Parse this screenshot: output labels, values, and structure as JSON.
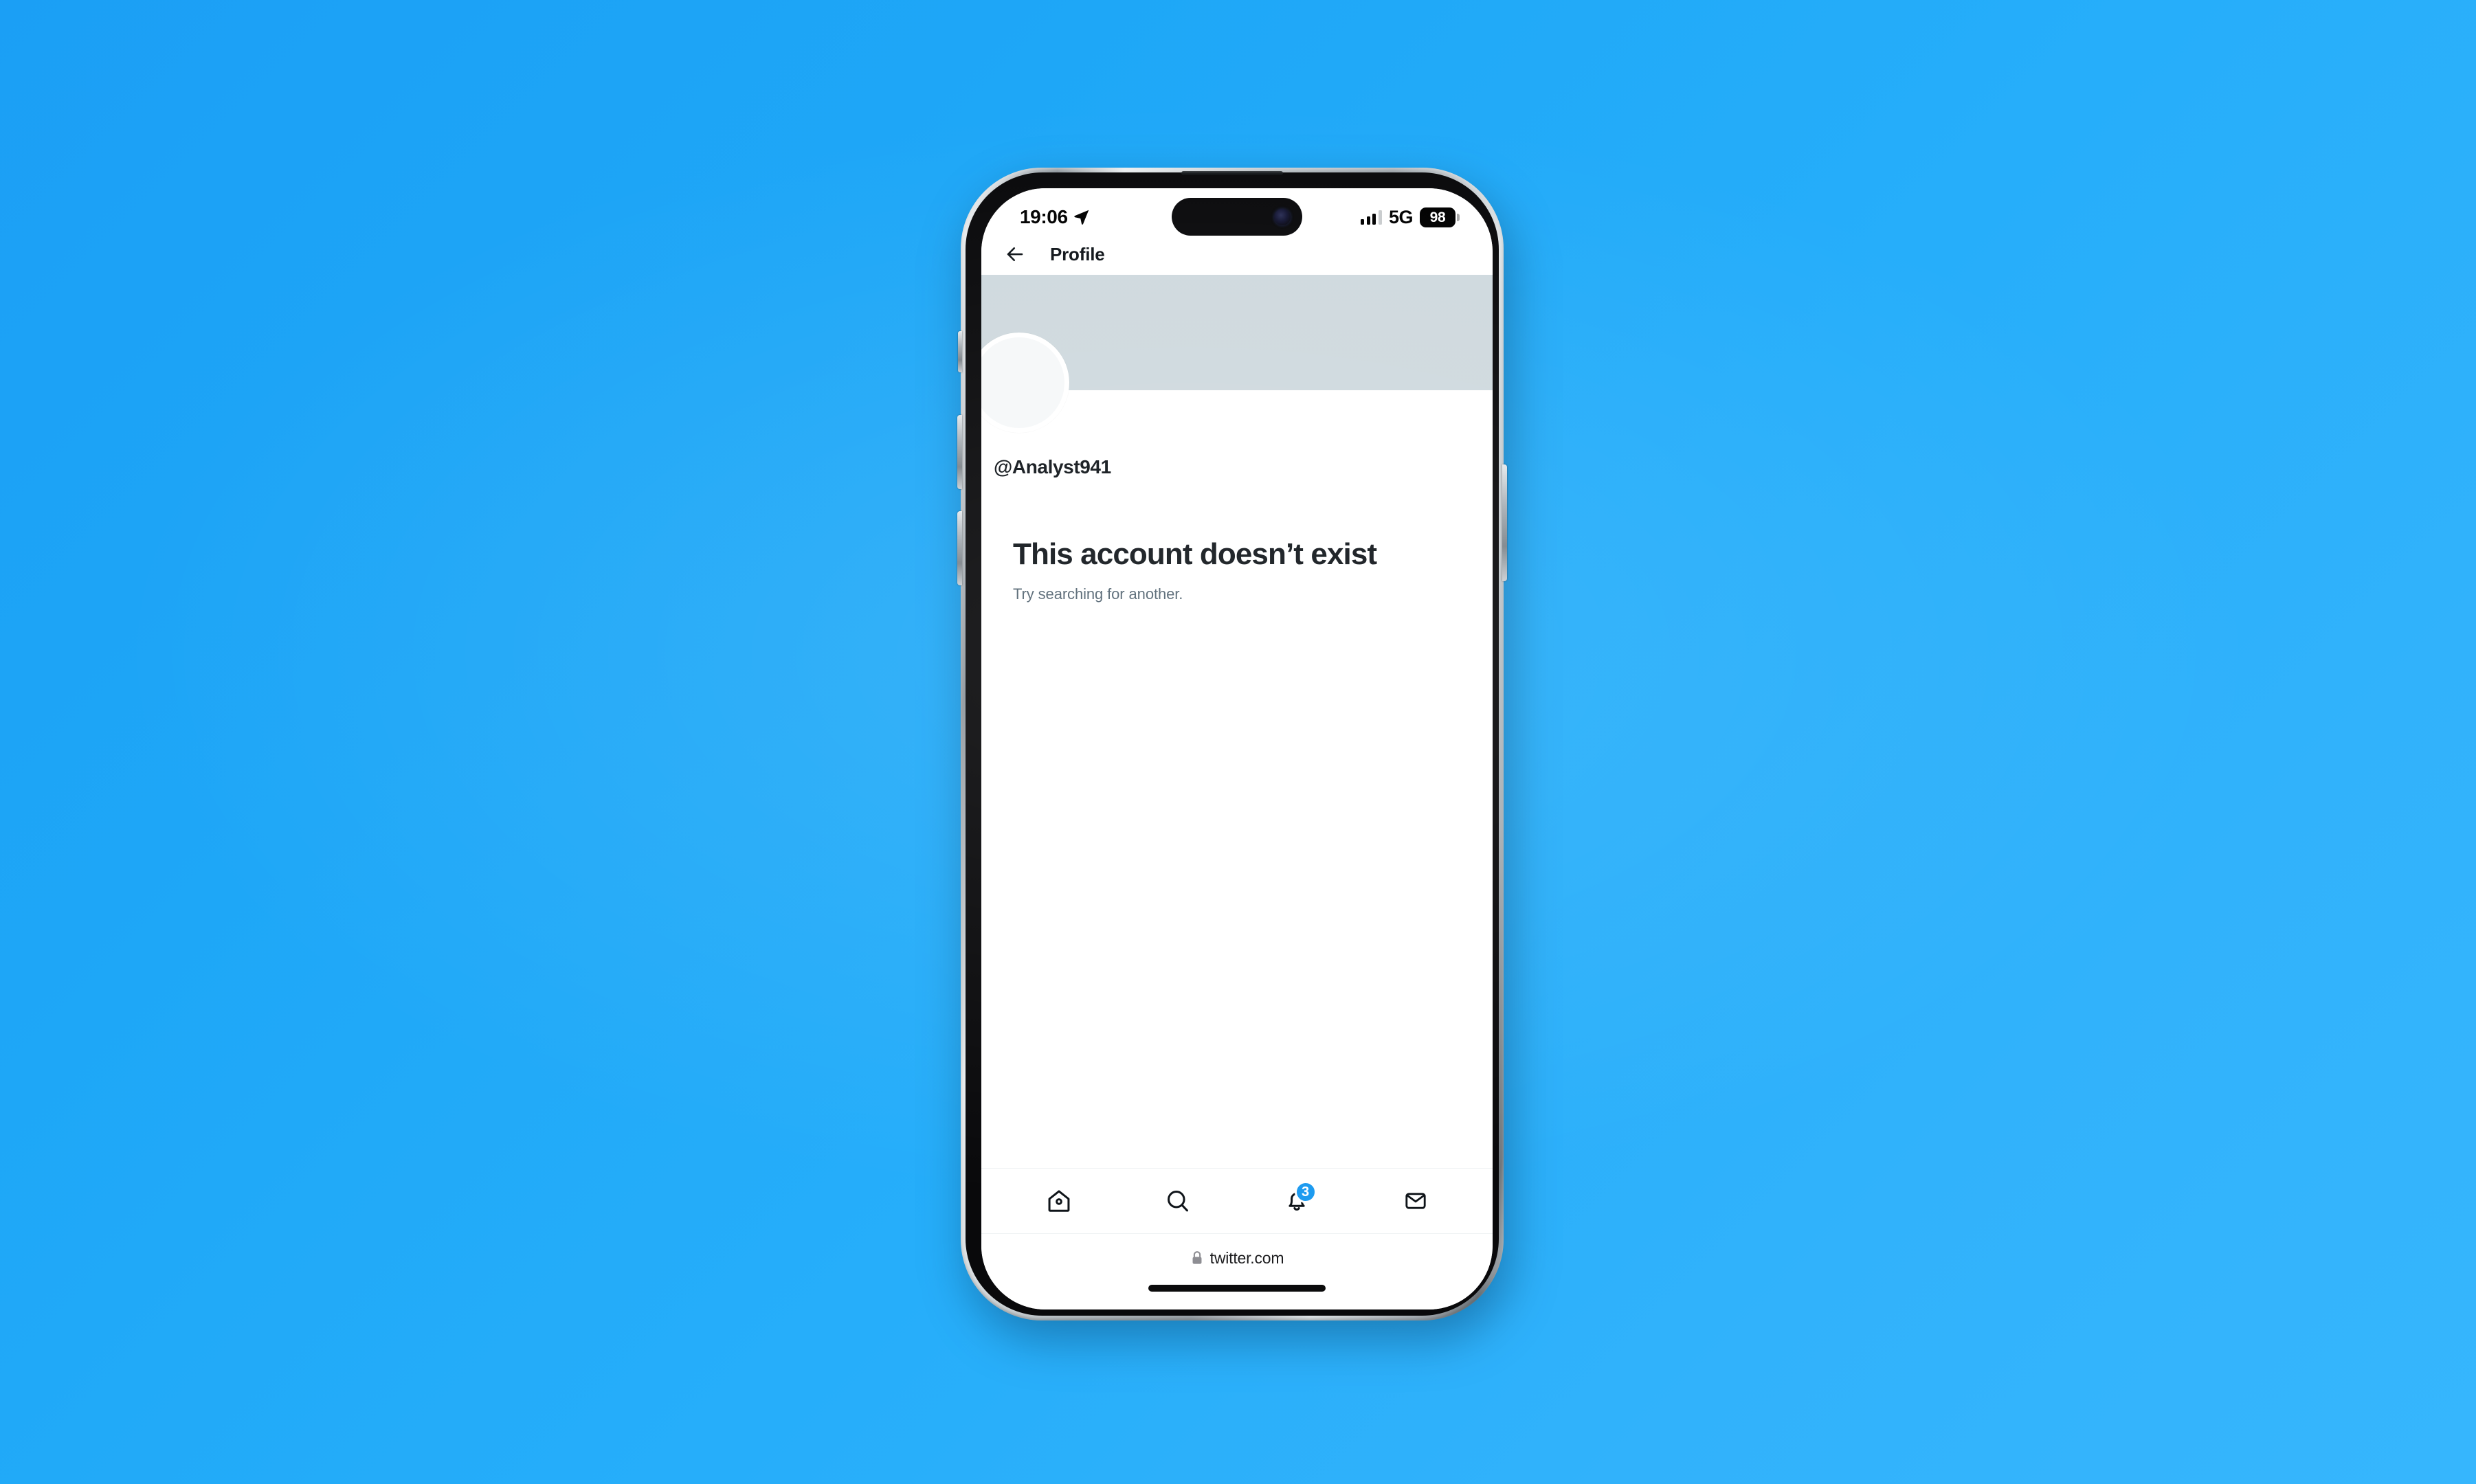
{
  "backdrop": {
    "color_start": "#1b9ff5",
    "color_end": "#36b6fd"
  },
  "device": {
    "model_name": "iphone-pro",
    "frame_color": "#b9c0c5",
    "bezel_color": "#09090b"
  },
  "status_bar": {
    "time": "19:06",
    "location_icon": "location-arrow-icon",
    "signal_icon": "cellular-bars-icon",
    "signal_bars_filled": 3,
    "signal_bars_total": 4,
    "network": "5G",
    "battery_percent": "98",
    "dynamic_island": "dynamic-island",
    "camera_icon": "front-camera-icon"
  },
  "app_header": {
    "back_icon": "arrow-left-icon",
    "title": "Profile"
  },
  "profile": {
    "banner_color": "#cfd9de",
    "avatar_icon": "default-avatar-icon",
    "avatar_color": "#f6f8f9",
    "handle": "@Analyst941"
  },
  "empty_state": {
    "title": "This account doesn’t exist",
    "subtitle": "Try searching for another."
  },
  "tab_bar": {
    "items": [
      {
        "name": "home",
        "icon": "home-icon",
        "label": "Home",
        "badge": null,
        "active": false
      },
      {
        "name": "search",
        "icon": "search-icon",
        "label": "Search",
        "badge": null,
        "active": false
      },
      {
        "name": "notifications",
        "icon": "bell-icon",
        "label": "Notifications",
        "badge": "3",
        "active": false
      },
      {
        "name": "messages",
        "icon": "envelope-icon",
        "label": "Messages",
        "badge": null,
        "active": false
      }
    ],
    "badge_color": "#1d9bf0"
  },
  "browser": {
    "lock_icon": "lock-icon",
    "url": "twitter.com"
  },
  "home_indicator": {
    "name": "home-indicator"
  }
}
